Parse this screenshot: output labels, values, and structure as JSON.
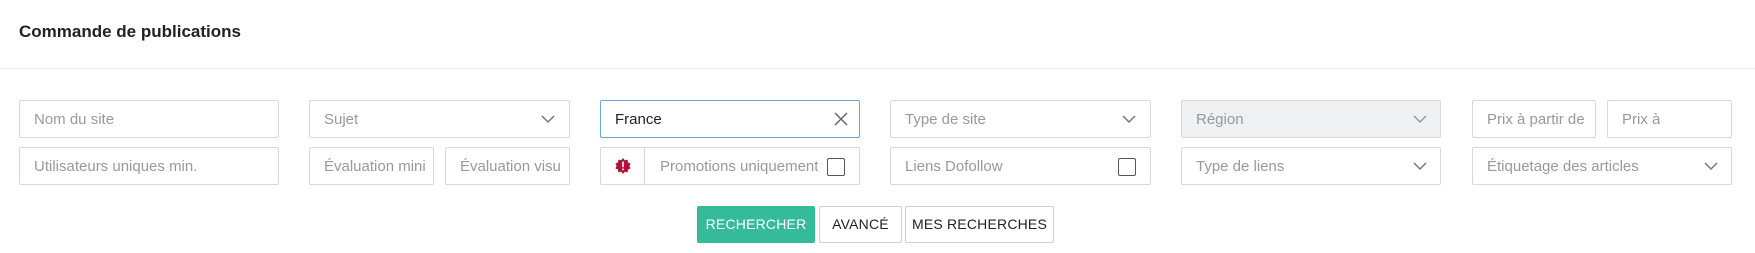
{
  "header": {
    "title": "Commande de publications"
  },
  "filters": {
    "site_name": {
      "placeholder": "Nom du site"
    },
    "subject": {
      "placeholder": "Sujet"
    },
    "country": {
      "value": "France"
    },
    "site_type": {
      "placeholder": "Type de site"
    },
    "region": {
      "placeholder": "Région"
    },
    "price_from": {
      "placeholder": "Prix à partir de"
    },
    "price_to": {
      "placeholder": "Prix à"
    },
    "unique_users": {
      "placeholder": "Utilisateurs uniques min."
    },
    "rating_min": {
      "placeholder": "Évaluation mini"
    },
    "rating_visual": {
      "placeholder": "Évaluation visu"
    },
    "promotions": {
      "label": "Promotions uniquement",
      "checked": false
    },
    "dofollow": {
      "label": "Liens Dofollow",
      "checked": false
    },
    "link_type": {
      "placeholder": "Type de liens"
    },
    "article_tagging": {
      "placeholder": "Étiquetage des articles"
    }
  },
  "actions": {
    "search_label": "RECHERCHER",
    "advanced_label": "AVANCÉ",
    "my_searches_label": "MES RECHERCHES"
  },
  "colors": {
    "primary": "#35bb9a",
    "focus_border": "#6ba4d9",
    "promo_icon": "#b0123c"
  },
  "icons": [
    "chevron-down-icon",
    "close-icon",
    "promo-badge-icon"
  ]
}
